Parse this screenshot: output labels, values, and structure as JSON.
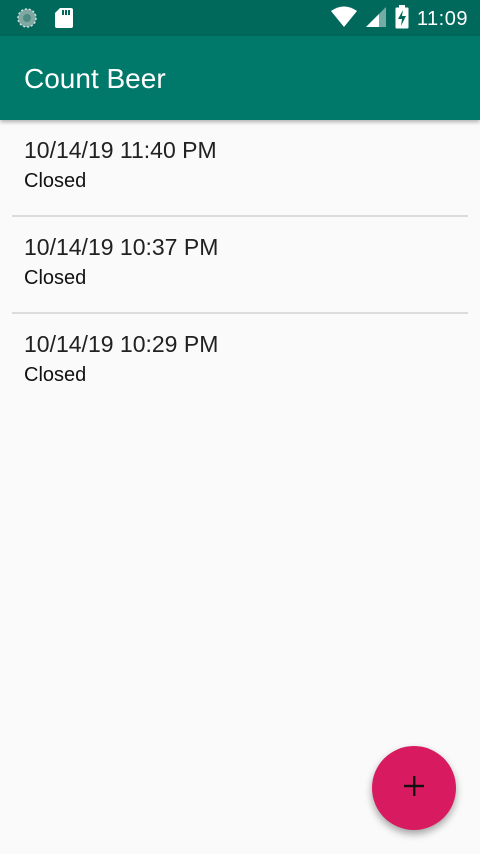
{
  "status_bar": {
    "time": "11:09",
    "icons": [
      "sync-icon",
      "sd-card-icon",
      "wifi-icon",
      "signal-icon",
      "battery-charging-icon"
    ]
  },
  "app_bar": {
    "title": "Count Beer"
  },
  "sessions": [
    {
      "datetime": "10/14/19 11:40 PM",
      "status": "Closed"
    },
    {
      "datetime": "10/14/19 10:37 PM",
      "status": "Closed"
    },
    {
      "datetime": "10/14/19 10:29 PM",
      "status": "Closed"
    }
  ],
  "fab": {
    "icon": "add-icon"
  },
  "colors": {
    "status_bar": "#00695c",
    "primary": "#00796b",
    "accent": "#d81b60",
    "background": "#fafafa"
  }
}
